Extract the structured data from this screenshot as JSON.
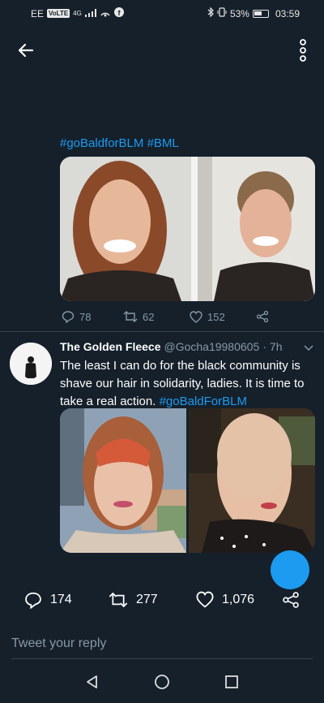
{
  "status_bar": {
    "carrier": "EE",
    "volte": "VoLTE",
    "network": "4G",
    "battery": "53%",
    "time": "03:59"
  },
  "tweet1": {
    "text": "#goBaldforBLM #BML",
    "actions": {
      "replies": "78",
      "retweets": "62",
      "likes": "152"
    }
  },
  "tweet2": {
    "name": "The Golden Fleece",
    "handle": "@Gocha19980605",
    "separator": "·",
    "time": "7h",
    "text": "The least I can do for the black community is shave our hair in solidarity, ladies. It is time to take a real action.",
    "hashtag": "#goBaldForBLM",
    "actions": {
      "replies": "174",
      "retweets": "277",
      "likes": "1,076"
    }
  },
  "reply": {
    "placeholder": "Tweet your reply"
  },
  "colors": {
    "background": "#15202b",
    "accent": "#1d9bf0",
    "muted": "#8899a6"
  }
}
